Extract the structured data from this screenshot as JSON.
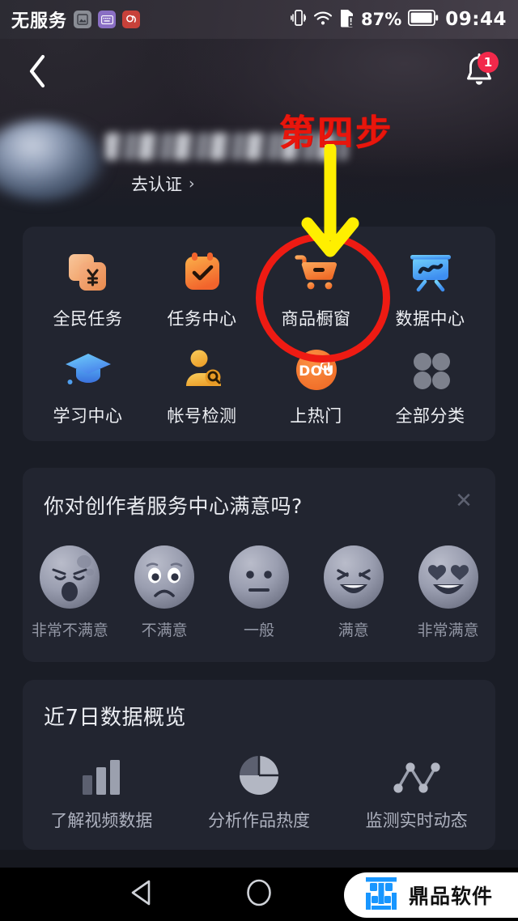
{
  "statusbar": {
    "carrier": "无服务",
    "app_icons": [
      "image-icon",
      "keyboard-icon",
      "app-red-icon"
    ],
    "vibrate_icon": "vibrate-icon",
    "wifi_icon": "wifi-icon",
    "sim_icon": "sim-alert-icon",
    "battery_percent": "87%",
    "battery_icon": "battery-icon",
    "time": "09:44"
  },
  "header": {
    "back_icon": "back-chevron-icon",
    "bell_icon": "bell-icon",
    "bell_badge": "1",
    "avatar": "avatar",
    "username": "",
    "verify_label": "去认证",
    "verify_chevron": "chevron-right-icon"
  },
  "grid": {
    "items": [
      {
        "label": "全民任务",
        "icon": "yen-cards-icon",
        "color": "#f4a97b"
      },
      {
        "label": "任务中心",
        "icon": "task-check-icon",
        "color": "#f37a3a"
      },
      {
        "label": "商品橱窗",
        "icon": "shopping-cart-icon",
        "color": "#f5853d"
      },
      {
        "label": "数据中心",
        "icon": "chart-board-icon",
        "color": "#54b7f5"
      },
      {
        "label": "学习中心",
        "icon": "graduation-cap-icon",
        "color": "#4aa9f0"
      },
      {
        "label": "帐号检测",
        "icon": "user-search-icon",
        "color": "#f0b93c"
      },
      {
        "label": "上热门",
        "icon": "dou-plus-icon",
        "color": "#f3762f"
      },
      {
        "label": "全部分类",
        "icon": "grid-dots-icon",
        "color": "#7b7f8c"
      }
    ]
  },
  "survey": {
    "question": "你对创作者服务中心满意吗?",
    "close_icon": "close-icon",
    "options": [
      {
        "label": "非常不满意",
        "face": "angry-face-icon"
      },
      {
        "label": "不满意",
        "face": "sad-face-icon"
      },
      {
        "label": "一般",
        "face": "neutral-face-icon"
      },
      {
        "label": "满意",
        "face": "happy-face-icon"
      },
      {
        "label": "非常满意",
        "face": "love-face-icon"
      }
    ]
  },
  "data_overview": {
    "title": "近7日数据概览",
    "items": [
      {
        "label": "了解视频数据",
        "icon": "bar-chart-icon"
      },
      {
        "label": "分析作品热度",
        "icon": "pie-chart-icon"
      },
      {
        "label": "监测实时动态",
        "icon": "line-chart-icon"
      }
    ]
  },
  "annotation": {
    "step_text": "第四步",
    "step_color": "#e8160c",
    "arrow_color": "#ffef00",
    "circle_color": "#ee1b13",
    "arrow_icon": "down-arrow-icon",
    "highlight_target": "商品橱窗"
  },
  "navbar": {
    "back_icon": "triangle-back-icon",
    "home_icon": "circle-home-icon",
    "watermark_text": "鼎品软件",
    "watermark_logo": "dingpin-logo-icon"
  }
}
